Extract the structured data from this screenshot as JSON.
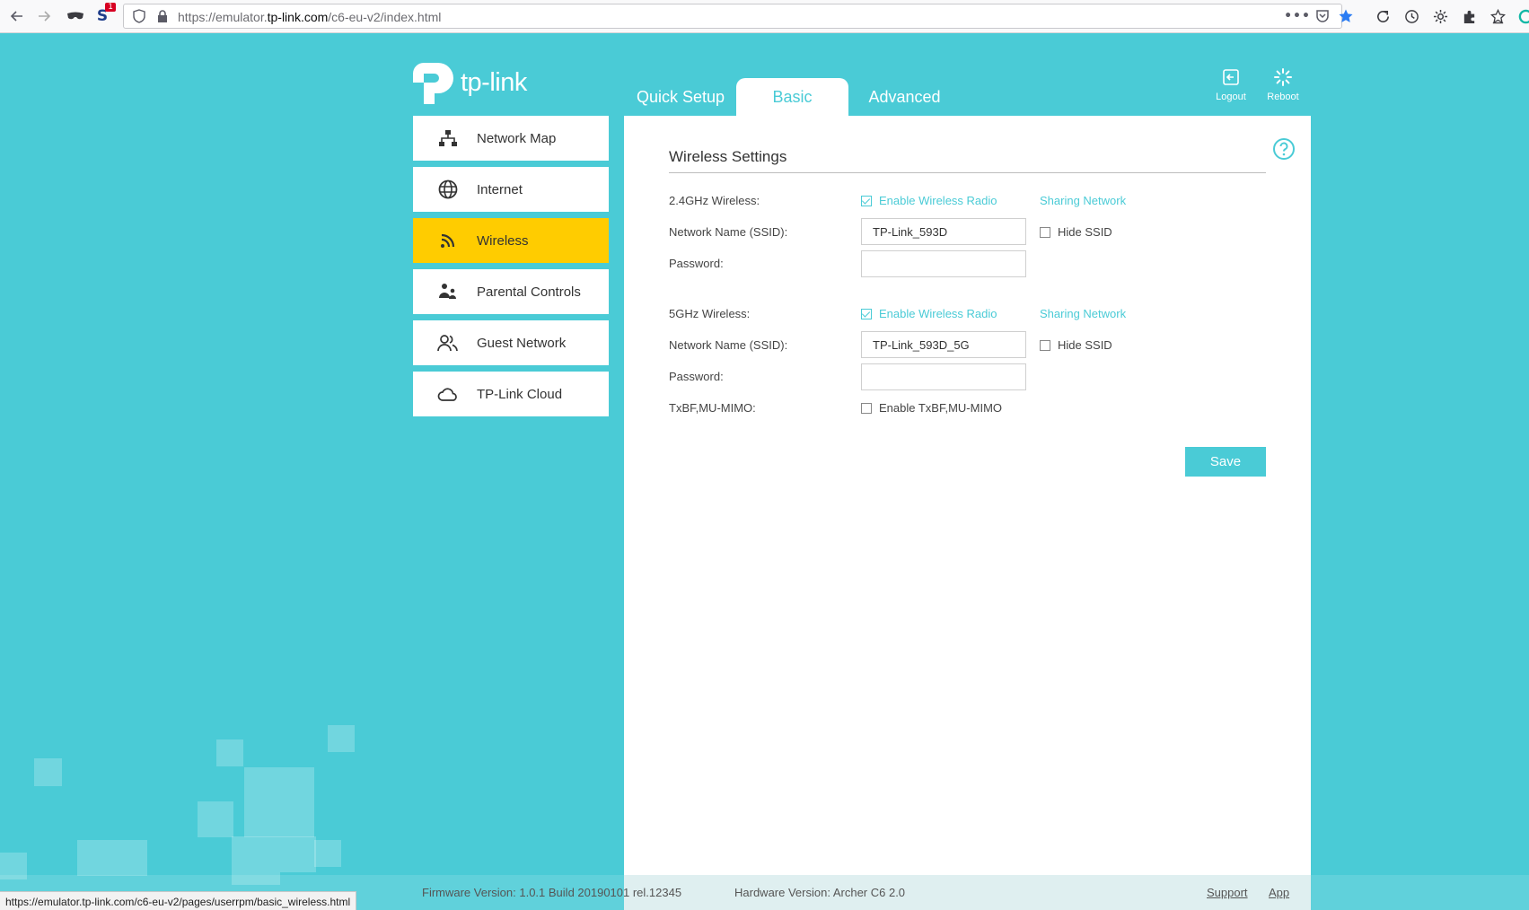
{
  "browser": {
    "url_prefix": "https://emulator.",
    "url_domain": "tp-link.com",
    "url_path": "/c6-eu-v2/index.html",
    "status_url": "https://emulator.tp-link.com/c6-eu-v2/pages/userrpm/basic_wireless.html",
    "extension_badge": "1"
  },
  "header": {
    "logo_text": "tp-link",
    "tabs": [
      {
        "label": "Quick Setup",
        "active": false
      },
      {
        "label": "Basic",
        "active": true
      },
      {
        "label": "Advanced",
        "active": false
      }
    ],
    "actions": [
      {
        "label": "Logout",
        "icon": "logout-icon"
      },
      {
        "label": "Reboot",
        "icon": "reboot-icon"
      }
    ]
  },
  "sidebar": {
    "items": [
      {
        "label": "Network Map",
        "icon": "network-map-icon",
        "active": false
      },
      {
        "label": "Internet",
        "icon": "globe-icon",
        "active": false
      },
      {
        "label": "Wireless",
        "icon": "wifi-icon",
        "active": true
      },
      {
        "label": "Parental Controls",
        "icon": "parental-controls-icon",
        "active": false
      },
      {
        "label": "Guest Network",
        "icon": "guest-network-icon",
        "active": false
      },
      {
        "label": "TP-Link Cloud",
        "icon": "cloud-icon",
        "active": false
      }
    ]
  },
  "main": {
    "title": "Wireless Settings",
    "band24": {
      "label": "2.4GHz Wireless:",
      "enable_label": "Enable Wireless Radio",
      "enabled": true,
      "sharing_link": "Sharing Network",
      "ssid_label": "Network Name (SSID):",
      "ssid_value": "TP-Link_593D",
      "hide_label": "Hide SSID",
      "hide_checked": false,
      "password_label": "Password:",
      "password_value": ""
    },
    "band5": {
      "label": "5GHz Wireless:",
      "enable_label": "Enable Wireless Radio",
      "enabled": true,
      "sharing_link": "Sharing Network",
      "ssid_label": "Network Name (SSID):",
      "ssid_value": "TP-Link_593D_5G",
      "hide_label": "Hide SSID",
      "hide_checked": false,
      "password_label": "Password:",
      "password_value": ""
    },
    "txbf": {
      "label": "TxBF,MU-MIMO:",
      "enable_label": "Enable TxBF,MU-MIMO",
      "checked": false
    },
    "save_label": "Save"
  },
  "footer": {
    "firmware": "Firmware Version: 1.0.1 Build 20190101 rel.12345",
    "hardware": "Hardware Version: Archer C6 2.0",
    "support_link": "Support",
    "app_link": "App"
  },
  "colors": {
    "brand": "#4acbd6",
    "active_item": "#ffcc00"
  }
}
